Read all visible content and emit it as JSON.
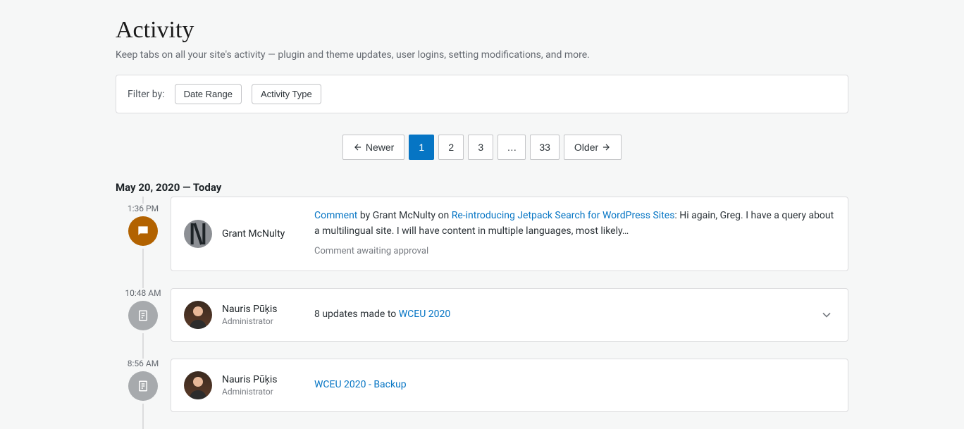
{
  "header": {
    "title": "Activity",
    "subtitle": "Keep tabs on all your site's activity — plugin and theme updates, user logins, setting modifications, and more."
  },
  "filters": {
    "label": "Filter by:",
    "date_range": "Date Range",
    "activity_type": "Activity Type"
  },
  "pagination": {
    "newer_label": "Newer",
    "older_label": "Older",
    "pages": [
      "1",
      "2",
      "3",
      "…",
      "33"
    ],
    "active": "1"
  },
  "date_header": "May 20, 2020 — Today",
  "items": [
    {
      "time": "1:36 PM",
      "icon": "comment",
      "actor_name": "Grant McNulty",
      "actor_sub": "",
      "link1": "Comment",
      "mid1": " by Grant McNulty on ",
      "link2": "Re-introducing Jetpack Search for WordPress Sites",
      "tail": ": Hi again, Greg. I have a query about a multilingual site. I will have content in multiple languages, most likely…",
      "meta": "Comment awaiting approval",
      "expandable": false
    },
    {
      "time": "10:48 AM",
      "icon": "page",
      "actor_name": "Nauris Pūķis",
      "actor_sub": "Administrator",
      "body_prefix": "8 updates made to ",
      "body_link": "WCEU 2020",
      "expandable": true
    },
    {
      "time": "8:56 AM",
      "icon": "page",
      "actor_name": "Nauris Pūķis",
      "actor_sub": "Administrator",
      "body_link_only": "WCEU 2020 - Backup",
      "expandable": false
    }
  ]
}
